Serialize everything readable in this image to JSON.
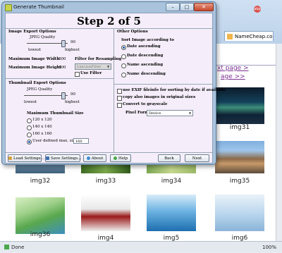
{
  "dialog": {
    "window_title": "Generate Thumbnail",
    "step_title": "Step 2 of 5",
    "window_buttons": {
      "minimize": "–",
      "maximize": "□",
      "close": "✕"
    }
  },
  "image_export": {
    "heading": "Image Export Options",
    "jpeg_quality_label": "JPEG Quality",
    "jpeg_quality_value": "90",
    "jpeg_quality_level": 0.9,
    "lowest_label": "lowest",
    "highest_label": "highest",
    "max_width_label": "Maximum Image Width",
    "max_width_value": "800",
    "max_height_label": "Maximum Image Height",
    "max_height_value": "600",
    "filter_label": "Filter for Resampling",
    "filter_value": "LanczosFilter",
    "use_filter_label": "Use Filter",
    "use_filter_checked": false
  },
  "thumbnail_export": {
    "heading": "Thumbnail Export Options",
    "jpeg_quality_label": "JPEG Quality",
    "jpeg_quality_value": "90",
    "jpeg_quality_level": 0.9,
    "lowest_label": "lowest",
    "highest_label": "highest",
    "max_size_heading": "Maximum Thumbnail Size",
    "sizes": [
      {
        "label": "120 x 120",
        "selected": false
      },
      {
        "label": "140 x 140",
        "selected": false
      },
      {
        "label": "160 x 160",
        "selected": false
      },
      {
        "label": "User defined max. size",
        "selected": true
      }
    ],
    "user_size_value": "160"
  },
  "other_options": {
    "heading": "Other Options",
    "sort_heading": "Sort Image according to",
    "sort_options": [
      {
        "label": "Date ascending",
        "selected": true
      },
      {
        "label": "Date descending",
        "selected": false
      },
      {
        "label": "Name ascending",
        "selected": false
      },
      {
        "label": "Name descending",
        "selected": false
      }
    ],
    "checkboxes": [
      {
        "label": "use EXIF fileinfo for sorting by date if available",
        "checked": false
      },
      {
        "label": "copy also images in original sizes",
        "checked": false
      },
      {
        "label": "Convert to grayscale",
        "checked": false
      }
    ],
    "pixel_format_label": "Pixel Format",
    "pixel_format_value": "Device"
  },
  "buttons": {
    "load": "Load Settings...",
    "save": "Save Settings...",
    "about": "About",
    "help": "Help",
    "back": "Back",
    "next": "Next"
  },
  "browser": {
    "tab_label": "NameCheap.co...",
    "search_badge": "abp",
    "link_next": "xt page >",
    "link_last": "age >>",
    "thumbnails": [
      "img31",
      "img32",
      "img33",
      "img34",
      "img35",
      "img36",
      "img4",
      "img5",
      "img6"
    ],
    "status_text": "Done",
    "zoom_text": "100%"
  },
  "colors": {
    "dialog_frame": "#a9c3dd",
    "dialog_client": "#f5eefa",
    "link": "#7a2f8f"
  }
}
